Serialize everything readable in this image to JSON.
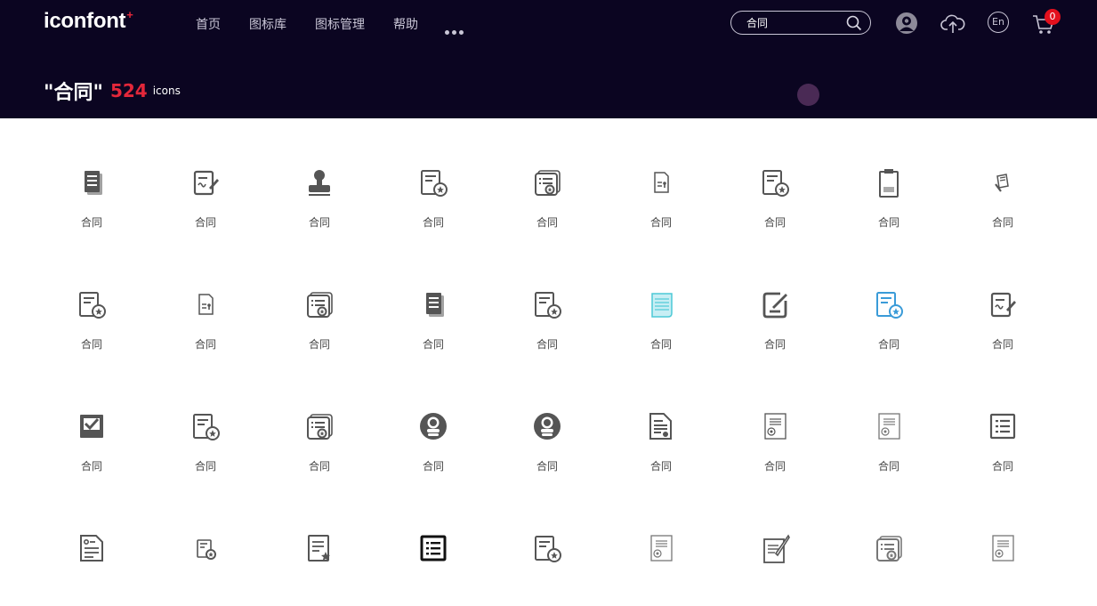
{
  "brand": {
    "name": "iconfont",
    "mark": "+"
  },
  "nav": {
    "items": [
      "首页",
      "图标库",
      "图标管理",
      "帮助"
    ]
  },
  "search": {
    "value": "合同"
  },
  "cart": {
    "count": "0"
  },
  "language": {
    "label": "En"
  },
  "results": {
    "query": "\"合同\"",
    "count": "524",
    "unit": "icons"
  },
  "icons": {
    "label": "合同",
    "items": [
      {
        "name": "icon-doc-stack-solid",
        "color": "#555555"
      },
      {
        "name": "icon-doc-pen",
        "color": "#555555"
      },
      {
        "name": "icon-stamp",
        "color": "#555555"
      },
      {
        "name": "icon-doc-seal",
        "color": "#555555"
      },
      {
        "name": "icon-certificate-seal",
        "color": "#555555"
      },
      {
        "name": "icon-doc-small",
        "color": "#555555"
      },
      {
        "name": "icon-doc-seal",
        "color": "#555555"
      },
      {
        "name": "icon-clipboard",
        "color": "#555555"
      },
      {
        "name": "icon-doc-small-pen",
        "color": "#555555"
      },
      {
        "name": "icon-doc-seal",
        "color": "#555555"
      },
      {
        "name": "icon-doc-small",
        "color": "#555555"
      },
      {
        "name": "icon-certificate-seal",
        "color": "#555555"
      },
      {
        "name": "icon-doc-stack-solid",
        "color": "#555555"
      },
      {
        "name": "icon-doc-seal",
        "color": "#555555"
      },
      {
        "name": "icon-scroll-cyan",
        "color": "#4cc9d6"
      },
      {
        "name": "icon-edit-square",
        "color": "#555555"
      },
      {
        "name": "icon-doc-seal-blue",
        "color": "#3a9bd8"
      },
      {
        "name": "icon-doc-pen",
        "color": "#555555"
      },
      {
        "name": "icon-check-box",
        "color": "#555555"
      },
      {
        "name": "icon-doc-seal",
        "color": "#555555"
      },
      {
        "name": "icon-certificate-seal",
        "color": "#555555"
      },
      {
        "name": "icon-badge-circle",
        "color": "#555555"
      },
      {
        "name": "icon-badge-circle",
        "color": "#555555"
      },
      {
        "name": "icon-doc-lines-seal",
        "color": "#555555"
      },
      {
        "name": "icon-doc-thin-seal",
        "color": "#555555"
      },
      {
        "name": "icon-doc-thin-seal",
        "color": "#777777"
      },
      {
        "name": "icon-list-box",
        "color": "#555555"
      },
      {
        "name": "icon-doc-form",
        "color": "#555555"
      },
      {
        "name": "icon-doc-seal-small",
        "color": "#555555"
      },
      {
        "name": "icon-doc-star",
        "color": "#555555"
      },
      {
        "name": "icon-list-box-bold",
        "color": "#111111"
      },
      {
        "name": "icon-doc-seal",
        "color": "#555555"
      },
      {
        "name": "icon-doc-thin-seal",
        "color": "#777777"
      },
      {
        "name": "icon-doc-quill",
        "color": "#555555"
      },
      {
        "name": "icon-certificate-seal",
        "color": "#777777"
      },
      {
        "name": "icon-doc-thin-seal",
        "color": "#777777"
      }
    ]
  }
}
